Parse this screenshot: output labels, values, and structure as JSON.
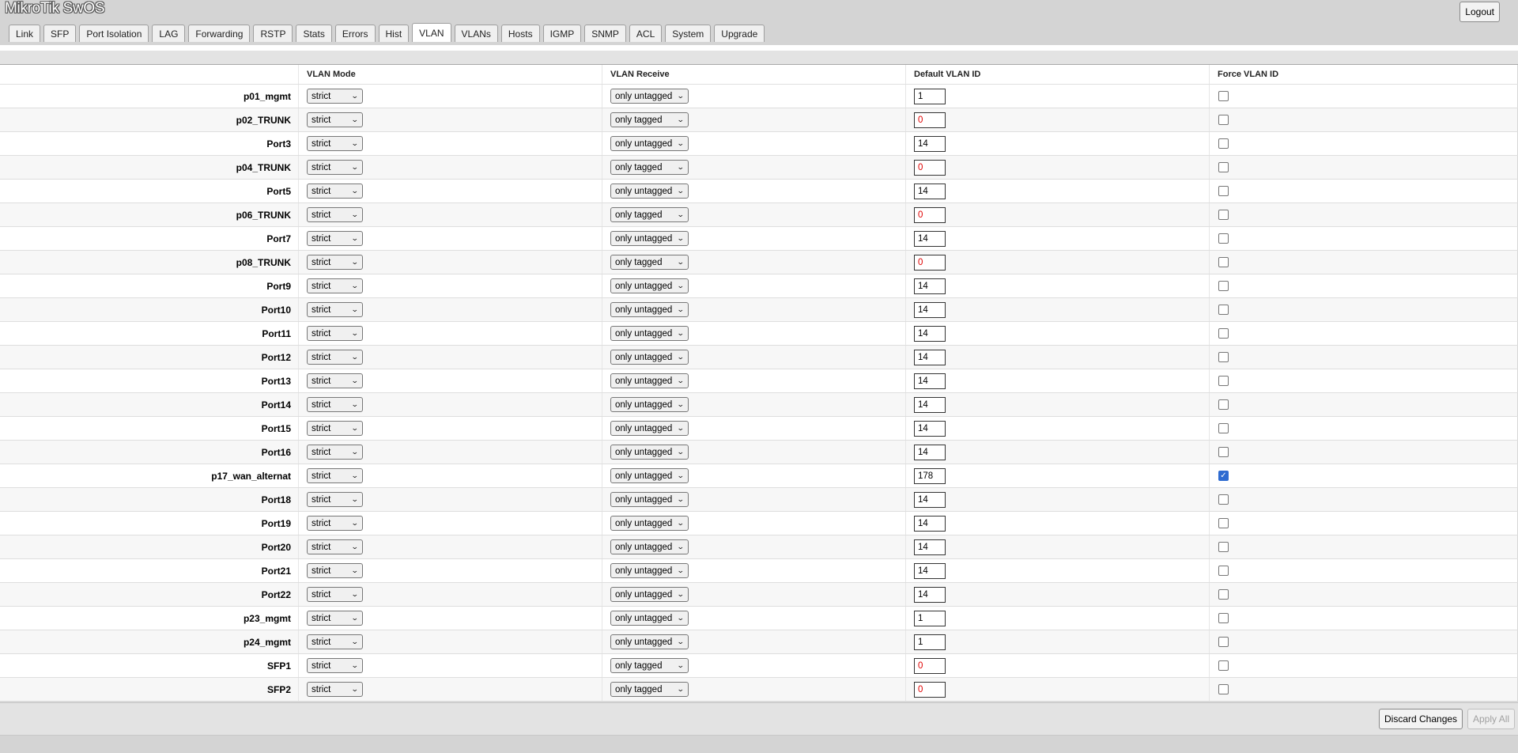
{
  "app": {
    "title": "MikroTik SwOS",
    "logout_label": "Logout"
  },
  "tabs": [
    "Link",
    "SFP",
    "Port Isolation",
    "LAG",
    "Forwarding",
    "RSTP",
    "Stats",
    "Errors",
    "Hist",
    "VLAN",
    "VLANs",
    "Hosts",
    "IGMP",
    "SNMP",
    "ACL",
    "System",
    "Upgrade"
  ],
  "active_tab": "VLAN",
  "columns": {
    "mode": "VLAN Mode",
    "receive": "VLAN Receive",
    "default_id": "Default VLAN ID",
    "force": "Force VLAN ID"
  },
  "ports": [
    {
      "name": "p01_mgmt",
      "mode": "strict",
      "receive": "only untagged",
      "vid": "1",
      "force": false
    },
    {
      "name": "p02_TRUNK",
      "mode": "strict",
      "receive": "only tagged",
      "vid": "0",
      "force": false
    },
    {
      "name": "Port3",
      "mode": "strict",
      "receive": "only untagged",
      "vid": "14",
      "force": false
    },
    {
      "name": "p04_TRUNK",
      "mode": "strict",
      "receive": "only tagged",
      "vid": "0",
      "force": false
    },
    {
      "name": "Port5",
      "mode": "strict",
      "receive": "only untagged",
      "vid": "14",
      "force": false
    },
    {
      "name": "p06_TRUNK",
      "mode": "strict",
      "receive": "only tagged",
      "vid": "0",
      "force": false
    },
    {
      "name": "Port7",
      "mode": "strict",
      "receive": "only untagged",
      "vid": "14",
      "force": false
    },
    {
      "name": "p08_TRUNK",
      "mode": "strict",
      "receive": "only tagged",
      "vid": "0",
      "force": false
    },
    {
      "name": "Port9",
      "mode": "strict",
      "receive": "only untagged",
      "vid": "14",
      "force": false
    },
    {
      "name": "Port10",
      "mode": "strict",
      "receive": "only untagged",
      "vid": "14",
      "force": false
    },
    {
      "name": "Port11",
      "mode": "strict",
      "receive": "only untagged",
      "vid": "14",
      "force": false
    },
    {
      "name": "Port12",
      "mode": "strict",
      "receive": "only untagged",
      "vid": "14",
      "force": false
    },
    {
      "name": "Port13",
      "mode": "strict",
      "receive": "only untagged",
      "vid": "14",
      "force": false
    },
    {
      "name": "Port14",
      "mode": "strict",
      "receive": "only untagged",
      "vid": "14",
      "force": false
    },
    {
      "name": "Port15",
      "mode": "strict",
      "receive": "only untagged",
      "vid": "14",
      "force": false
    },
    {
      "name": "Port16",
      "mode": "strict",
      "receive": "only untagged",
      "vid": "14",
      "force": false
    },
    {
      "name": "p17_wan_alternat",
      "mode": "strict",
      "receive": "only untagged",
      "vid": "178",
      "force": true
    },
    {
      "name": "Port18",
      "mode": "strict",
      "receive": "only untagged",
      "vid": "14",
      "force": false
    },
    {
      "name": "Port19",
      "mode": "strict",
      "receive": "only untagged",
      "vid": "14",
      "force": false
    },
    {
      "name": "Port20",
      "mode": "strict",
      "receive": "only untagged",
      "vid": "14",
      "force": false
    },
    {
      "name": "Port21",
      "mode": "strict",
      "receive": "only untagged",
      "vid": "14",
      "force": false
    },
    {
      "name": "Port22",
      "mode": "strict",
      "receive": "only untagged",
      "vid": "14",
      "force": false
    },
    {
      "name": "p23_mgmt",
      "mode": "strict",
      "receive": "only untagged",
      "vid": "1",
      "force": false
    },
    {
      "name": "p24_mgmt",
      "mode": "strict",
      "receive": "only untagged",
      "vid": "1",
      "force": false
    },
    {
      "name": "SFP1",
      "mode": "strict",
      "receive": "only tagged",
      "vid": "0",
      "force": false
    },
    {
      "name": "SFP2",
      "mode": "strict",
      "receive": "only tagged",
      "vid": "0",
      "force": false
    }
  ],
  "footer": {
    "discard_label": "Discard Changes",
    "apply_label": "Apply All"
  },
  "colors": {
    "zero_vid": "#e00000",
    "checked": "#2e6bd1"
  }
}
